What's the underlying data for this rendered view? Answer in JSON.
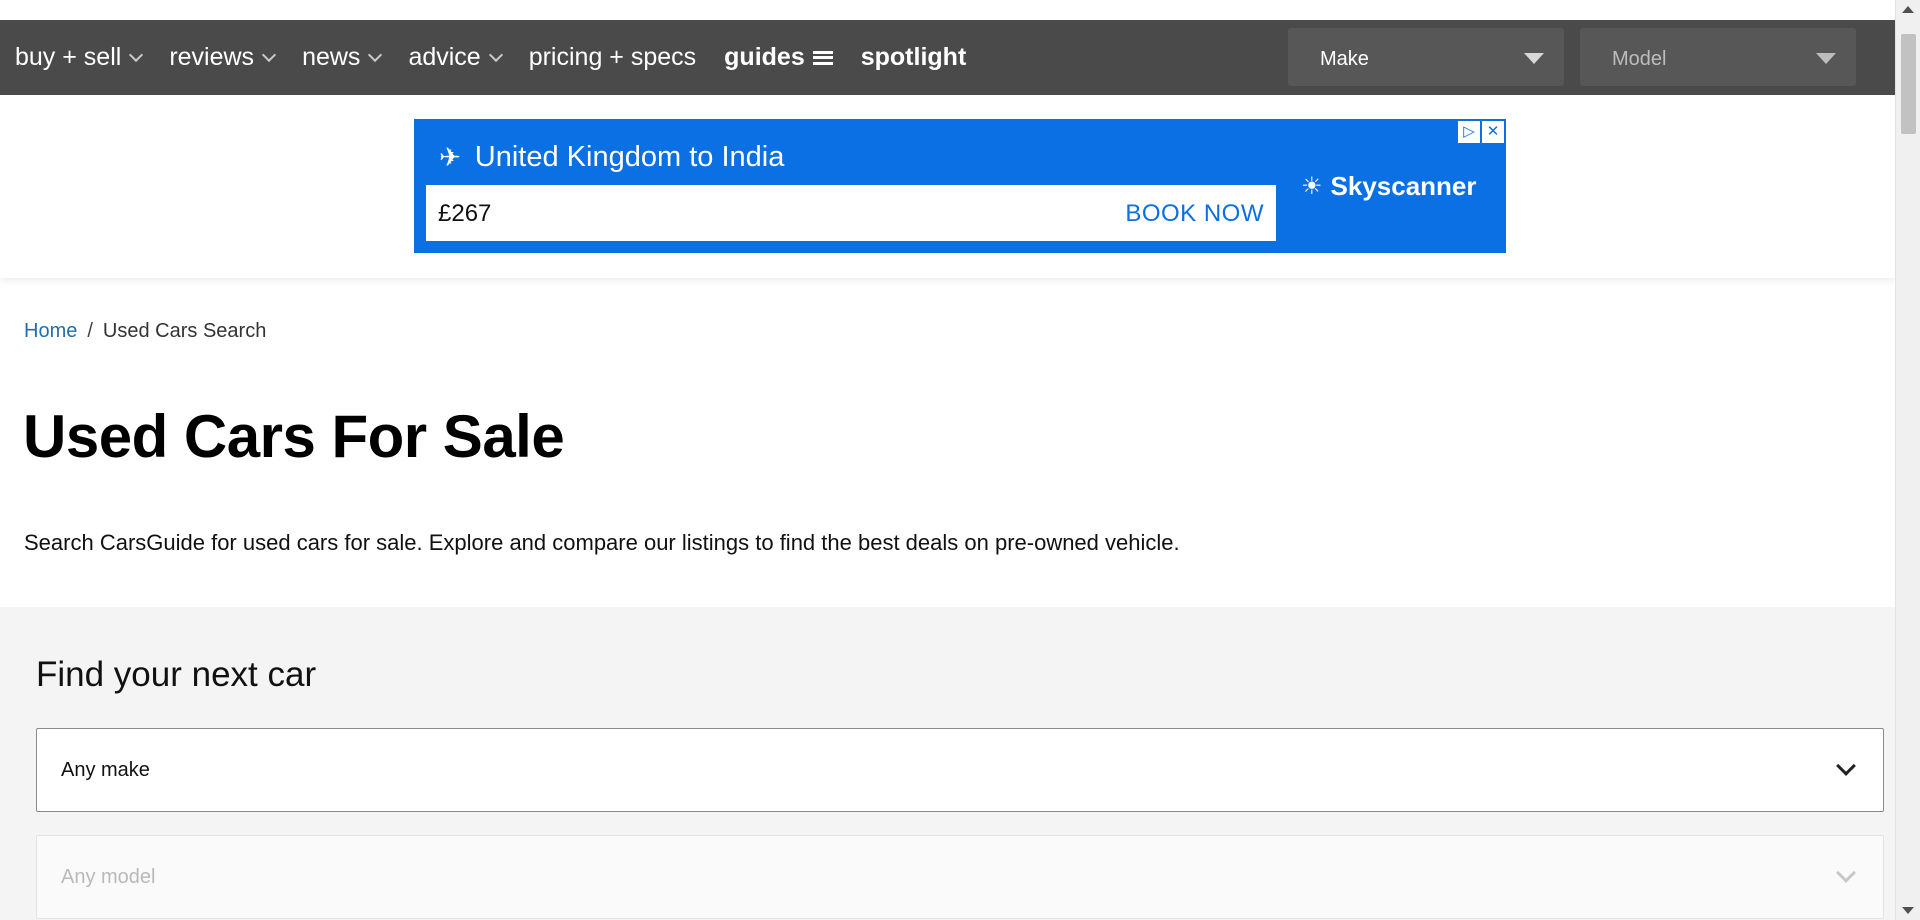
{
  "nav": {
    "items": [
      {
        "label": "buy + sell",
        "dropdown": true
      },
      {
        "label": "reviews",
        "dropdown": true
      },
      {
        "label": "news",
        "dropdown": true
      },
      {
        "label": "advice",
        "dropdown": true
      },
      {
        "label": "pricing + specs",
        "dropdown": false
      },
      {
        "label": "guides",
        "dropdown": false
      },
      {
        "label": "spotlight",
        "dropdown": false
      }
    ],
    "make_select": "Make",
    "model_select": "Model"
  },
  "ad": {
    "route": "United Kingdom to India",
    "price": "£267",
    "cta": "BOOK NOW",
    "brand": "Skyscanner",
    "bg_color": "#0b70e3"
  },
  "breadcrumb": {
    "home": "Home",
    "separator": "/",
    "current": "Used Cars Search"
  },
  "page": {
    "title": "Used Cars For Sale",
    "description": "Search CarsGuide for used cars for sale. Explore and compare our listings to find the best deals on pre-owned vehicle."
  },
  "search": {
    "title": "Find your next car",
    "make_value": "Any make",
    "model_value": "Any model"
  }
}
